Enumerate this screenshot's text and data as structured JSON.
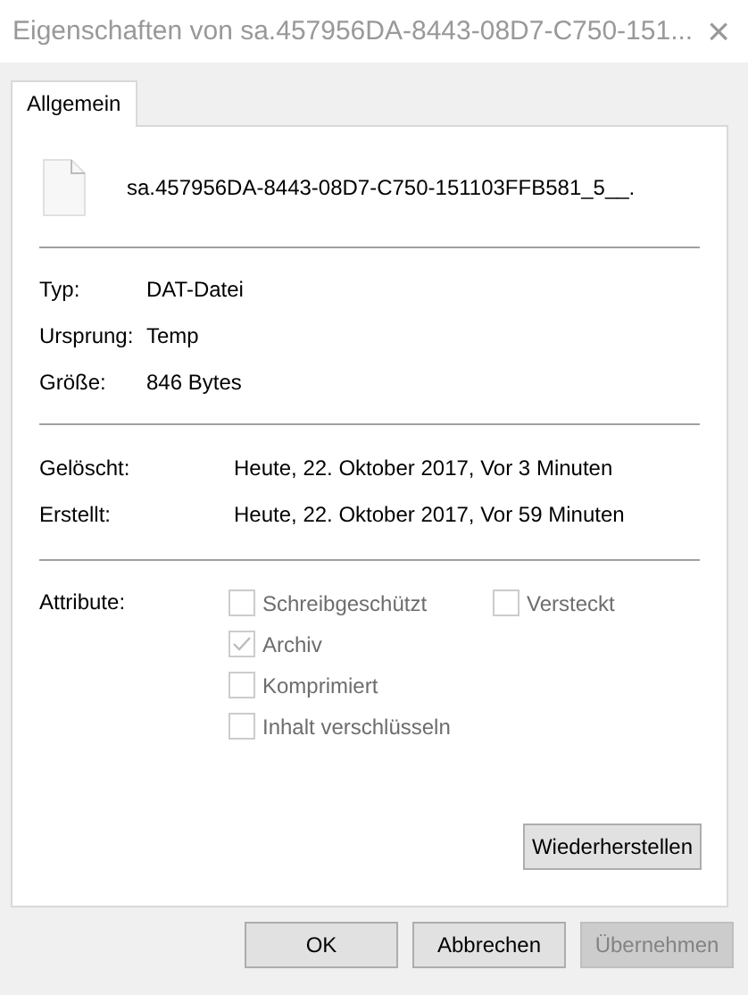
{
  "window": {
    "title": "Eigenschaften von sa.457956DA-8443-08D7-C750-151...",
    "close": "×"
  },
  "tabs": [
    {
      "label": "Allgemein",
      "selected": true
    }
  ],
  "file": {
    "name": "sa.457956DA-8443-08D7-C750-151103FFB581_5__."
  },
  "info": [
    {
      "label": "Typ:",
      "value": "DAT-Datei"
    },
    {
      "label": "Ursprung:",
      "value": "Temp"
    },
    {
      "label": "Größe:",
      "value": "846 Bytes"
    }
  ],
  "dates": [
    {
      "label": "Gelöscht:",
      "value": "Heute, 22. Oktober 2017, Vor 3 Minuten"
    },
    {
      "label": "Erstellt:",
      "value": "Heute, 22. Oktober 2017, Vor 59 Minuten"
    }
  ],
  "attributes": {
    "label": "Attribute:",
    "rows": [
      [
        {
          "label": "Schreibgeschützt",
          "checked": false,
          "disabled": true
        },
        {
          "label": "Versteckt",
          "checked": false,
          "disabled": true
        }
      ],
      [
        {
          "label": "Archiv",
          "checked": true,
          "disabled": true
        }
      ],
      [
        {
          "label": "Komprimiert",
          "checked": false,
          "disabled": true
        }
      ],
      [
        {
          "label": "Inhalt verschlüsseln",
          "checked": false,
          "disabled": true
        }
      ]
    ]
  },
  "restore_button": {
    "label": "Wiederherstellen"
  },
  "buttons": [
    {
      "label": "OK",
      "disabled": false
    },
    {
      "label": "Abbrechen",
      "disabled": false
    },
    {
      "label": "Übernehmen",
      "disabled": true
    }
  ]
}
